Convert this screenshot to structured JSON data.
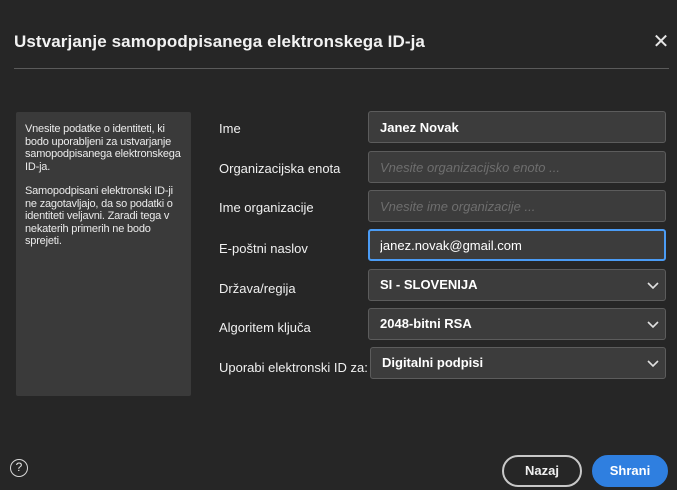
{
  "dialog": {
    "title": "Ustvarjanje samopodpisanega elektronskega ID-ja",
    "close_icon": "close-icon",
    "close_glyph": "✕"
  },
  "info": {
    "paragraph1": "Vnesite podatke o identiteti, ki bodo uporabljeni za ustvarjanje samopodpisanega elektronskega ID-ja.",
    "paragraph2": "Samopodpisani elektronski ID-ji ne zagotavljajo, da so podatki o identiteti veljavni. Zaradi tega v nekaterih primerih ne bodo sprejeti."
  },
  "form": {
    "name": {
      "label": "Ime",
      "value": "Janez Novak"
    },
    "org_unit": {
      "label": "Organizacijska enota",
      "value": "",
      "placeholder": "Vnesite organizacijsko enoto ..."
    },
    "org_name": {
      "label": "Ime organizacije",
      "value": "",
      "placeholder": "Vnesite ime organizacije ..."
    },
    "email": {
      "label": "E-poštni naslov",
      "value": "janez.novak@gmail.com"
    },
    "country": {
      "label": "Država/regija",
      "selected": "SI - SLOVENIJA"
    },
    "key_algorithm": {
      "label": "Algoritem ključa",
      "selected": "2048-bitni RSA"
    },
    "use_for": {
      "label": "Uporabi elektronski ID za:",
      "selected": "Digitalni podpisi"
    }
  },
  "footer": {
    "help_icon": "help-icon",
    "help_glyph": "?",
    "back_label": "Nazaj",
    "save_label": "Shrani"
  },
  "colors": {
    "background": "#262626",
    "panel": "#3a3a3a",
    "field": "#3c3c3c",
    "accent": "#2f7fe0",
    "focus": "#4b9cf5"
  }
}
